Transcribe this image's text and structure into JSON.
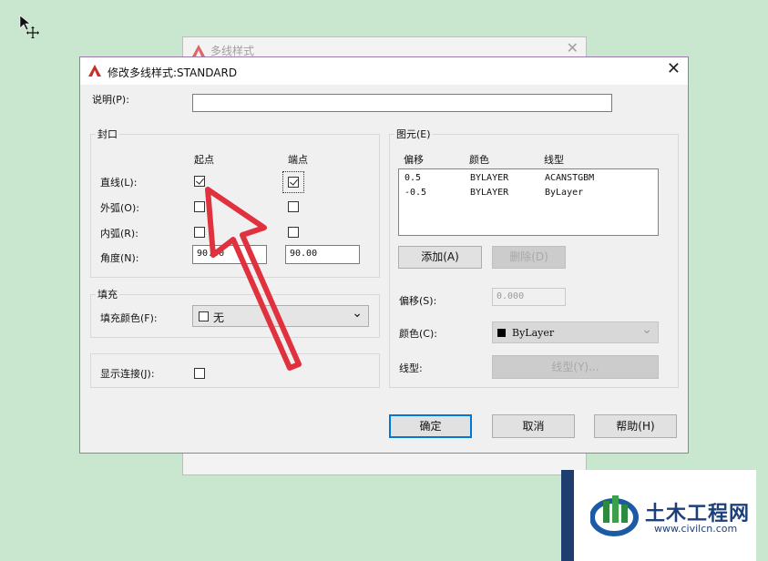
{
  "background_window": {
    "title": "多线样式",
    "close_glyph": "✕"
  },
  "dialog": {
    "title": "修改多线样式:STANDARD",
    "close_glyph": "✕",
    "description_label": "说明(P):",
    "description_value": "",
    "caps": {
      "title": "封口",
      "start_header": "起点",
      "end_header": "端点",
      "rows": [
        {
          "label": "直线(L):",
          "start": true,
          "end": true
        },
        {
          "label": "外弧(O):",
          "start": false,
          "end": false
        },
        {
          "label": "内弧(R):",
          "start": false,
          "end": false
        }
      ],
      "angle_label": "角度(N):",
      "angle_start": "90.00",
      "angle_end": "90.00"
    },
    "fill": {
      "title": "填充",
      "color_label": "填充颜色(F):",
      "color_value": "无",
      "chevron": "⌄"
    },
    "display_joints_label": "显示连接(J):",
    "display_joints_checked": false,
    "elements": {
      "title": "图元(E)",
      "headers": [
        "偏移",
        "颜色",
        "线型"
      ],
      "rows": [
        [
          "0.5",
          "BYLAYER",
          "ACANSTGBM"
        ],
        [
          "-0.5",
          "BYLAYER",
          "ByLayer"
        ]
      ],
      "add_button": "添加(A)",
      "delete_button": "删除(D)",
      "offset_label": "偏移(S):",
      "offset_value": "0.000",
      "color_label": "颜色(C):",
      "color_value": "ByLayer",
      "linetype_label": "线型:",
      "linetype_button": "线型(Y)..."
    },
    "ok_button": "确定",
    "cancel_button": "取消",
    "help_button": "帮助(H)"
  },
  "watermark": {
    "brand": "土木工程网",
    "url": "www.civilcn.com"
  },
  "colors": {
    "annotation_arrow": "#e0313f",
    "accent": "#0078d7",
    "autocad_red": "#c8302a"
  }
}
